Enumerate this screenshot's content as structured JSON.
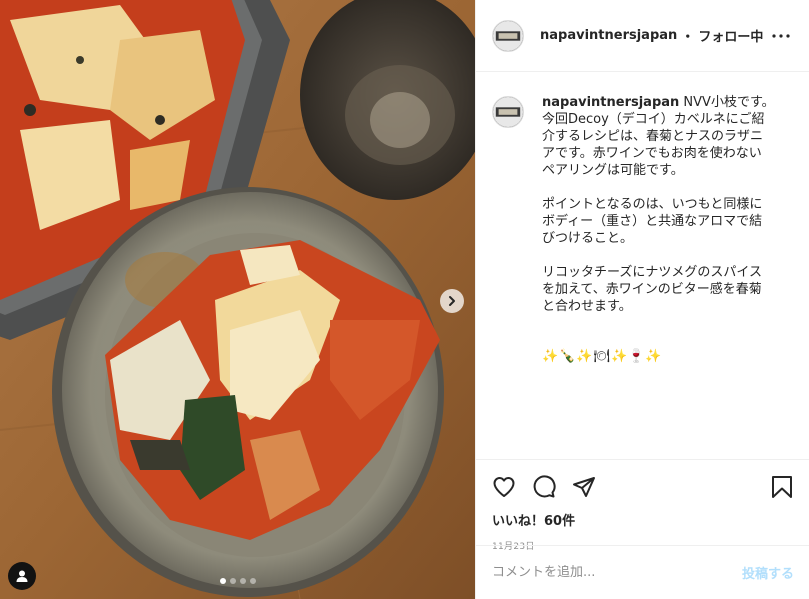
{
  "account": {
    "username": "napavintnersjapan",
    "separator": "・",
    "follow_status": "フォロー中"
  },
  "caption": {
    "username": "napavintnersjapan",
    "first_line": " NVV小枝です。",
    "paragraph1": "今回Decoy（デコイ）カベルネにご紹\n介するレシピは、春菊とナスのラザニ\nアです。赤ワインでもお肉を使わない\nペアリングは可能です。",
    "paragraph2": "ポイントとなるのは、いつもと同様に\nボディー（重さ）と共通なアロマで結\nびつけること。",
    "paragraph3": "リコッタチーズにナツメグのスパイス\nを加えて、赤ワインのビター感を春菊\nと合わせます。",
    "emojis": "✨🍾✨🍽✨🍷✨"
  },
  "engagement": {
    "likes": "いいね！60件",
    "date": "11月23日"
  },
  "comment_box": {
    "placeholder": "コメントを追加...",
    "post_label": "投稿する"
  },
  "carousel": {
    "slide_count": 4,
    "active_index": 0
  },
  "icons": {
    "more": "more-icon",
    "like": "heart-icon",
    "comment": "comment-icon",
    "share": "send-icon",
    "save": "bookmark-icon",
    "next": "chevron-right-icon",
    "tagged": "user-tag-icon"
  },
  "colors": {
    "text": "#262626",
    "muted": "#8e8e8e",
    "post_button_disabled": "#b2dffc",
    "border": "#efefef"
  }
}
